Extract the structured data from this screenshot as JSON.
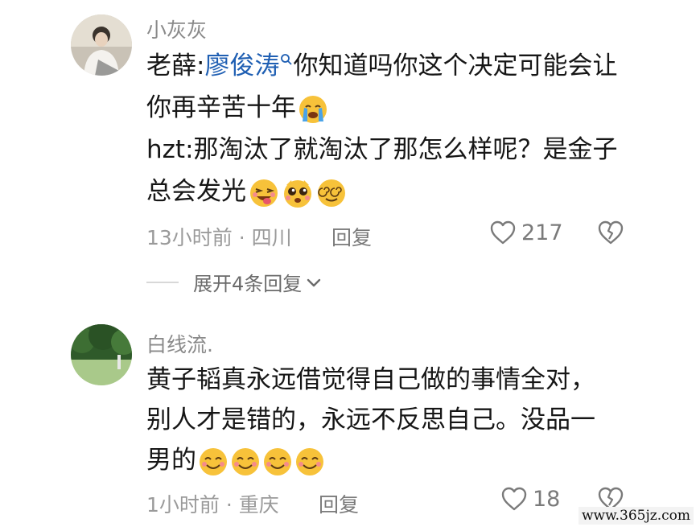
{
  "comments": [
    {
      "username": "小灰灰",
      "avatar_icon": "person-avatar",
      "lines": [
        {
          "prefix": "老薛:",
          "mention": "廖俊涛",
          "mention_icon": "search-icon",
          "suffix": "你知道吗你这个决定可能会让"
        },
        {
          "text": "你再辛苦十年",
          "emoji": [
            "crying-face-emoji"
          ]
        },
        {
          "text": "hzt:那淘汰了就淘汰了那怎么样呢？是金子"
        },
        {
          "text": "总会发光",
          "emoji": [
            "winking-tongue-emoji",
            "pleading-face-emoji",
            "dizzy-face-emoji"
          ]
        }
      ],
      "time": "13小时前",
      "separator": "·",
      "location": "四川",
      "reply_label": "回复",
      "likes": "217"
    },
    {
      "username": "白线流.",
      "avatar_icon": "landscape-avatar",
      "lines": [
        {
          "text": "黄子韬真永远借觉得自己做的事情全对，"
        },
        {
          "text": "别人才是错的，永远不反思自己。没品一"
        },
        {
          "text": "男的",
          "emoji": [
            "smiling-face-emoji",
            "smiling-face-emoji",
            "smiling-face-emoji",
            "smiling-face-emoji"
          ]
        }
      ],
      "time": "1小时前",
      "separator": "·",
      "location": "重庆",
      "reply_label": "回复",
      "likes": "18"
    }
  ],
  "expand_replies": {
    "label": "展开4条回复",
    "icon": "chevron-down-icon"
  },
  "watermark": "www.365jz.com",
  "colors": {
    "mention": "#1f5fb3",
    "meta": "#9a9a9a",
    "emoji_face": "#f7c23a"
  }
}
